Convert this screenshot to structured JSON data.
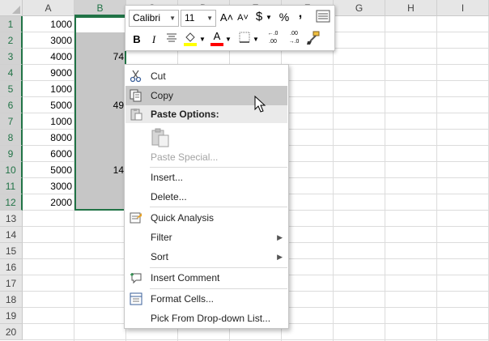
{
  "sheet": {
    "columns": [
      "A",
      "B",
      "C",
      "D",
      "E",
      "F",
      "G",
      "H",
      "I"
    ],
    "selected_column": "B",
    "rows": [
      "1",
      "2",
      "3",
      "4",
      "5",
      "6",
      "7",
      "8",
      "9",
      "10",
      "11",
      "12",
      "13",
      "14",
      "15",
      "16",
      "17",
      "18",
      "19",
      "20"
    ],
    "column_a_values": [
      "1000",
      "3000",
      "4000",
      "9000",
      "1000",
      "5000",
      "1000",
      "8000",
      "6000",
      "5000",
      "3000",
      "2000"
    ],
    "column_b_partial": [
      {
        "row": 3,
        "text": "74"
      },
      {
        "row": 6,
        "text": "49"
      },
      {
        "row": 10,
        "text": "14"
      }
    ]
  },
  "minibar": {
    "font_name": "Calibri",
    "font_size": "11",
    "grow_font": "A˄",
    "shrink_font": "A˅",
    "currency": "$",
    "percent": "%",
    "comma": ",",
    "bold": "B",
    "italic": "I",
    "font_color": "A",
    "increase_decimal": "←.0 .00",
    "decrease_decimal": ".00 →.0"
  },
  "context_menu": {
    "items": [
      {
        "label": "Cut",
        "icon": "scissors-icon"
      },
      {
        "label": "Copy",
        "icon": "copy-icon",
        "hover": true
      },
      {
        "label": "Paste Options:",
        "icon": "paste-icon",
        "header": true
      },
      {
        "label": "",
        "icon": "paste-option-icon"
      },
      {
        "label": "Paste Special...",
        "disabled": true
      },
      {
        "label": "Insert..."
      },
      {
        "label": "Delete..."
      },
      {
        "label": "Quick Analysis",
        "icon": "quick-analysis-icon"
      },
      {
        "label": "Filter",
        "submenu": true
      },
      {
        "label": "Sort",
        "submenu": true
      },
      {
        "label": "Insert Comment",
        "icon": "comment-icon"
      },
      {
        "label": "Format Cells...",
        "icon": "format-cells-icon"
      },
      {
        "label": "Pick From Drop-down List..."
      }
    ]
  },
  "colors": {
    "accent": "#217346",
    "selection_fill": "#c6c6c6",
    "fill_yellow": "#ffff00",
    "font_red": "#ff0000"
  }
}
